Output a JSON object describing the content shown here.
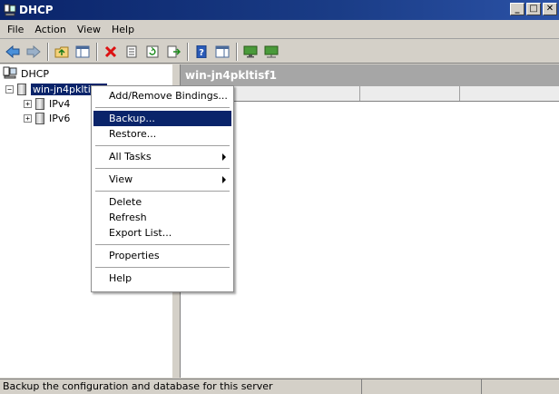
{
  "window": {
    "title": "DHCP",
    "minimize": "_",
    "maximize": "□",
    "close": "✕"
  },
  "menubar": [
    "File",
    "Action",
    "View",
    "Help"
  ],
  "toolbar": {
    "icons": [
      "back-arrow-icon",
      "forward-arrow-icon",
      "up-folder-icon",
      "show-hide-tree-icon",
      "delete-icon",
      "properties-icon",
      "refresh-icon",
      "export-list-icon",
      "help-icon",
      "show-pane-icon",
      "monitor-icon",
      "monitor-network-icon"
    ]
  },
  "tree": {
    "root": "DHCP",
    "server": "win-jn4pkltisf1",
    "children": [
      "IPv4",
      "IPv6"
    ]
  },
  "detail": {
    "header": "win-jn4pkltisf1"
  },
  "context_menu": {
    "items": [
      {
        "label": "Add/Remove Bindings..."
      },
      {
        "separator": true
      },
      {
        "label": "Backup...",
        "highlighted": true
      },
      {
        "label": "Restore..."
      },
      {
        "separator": true
      },
      {
        "label": "All Tasks",
        "submenu": true
      },
      {
        "separator": true
      },
      {
        "label": "View",
        "submenu": true
      },
      {
        "separator": true
      },
      {
        "label": "Delete"
      },
      {
        "label": "Refresh"
      },
      {
        "label": "Export List..."
      },
      {
        "separator": true
      },
      {
        "label": "Properties"
      },
      {
        "separator": true
      },
      {
        "label": "Help"
      }
    ]
  },
  "statusbar": {
    "text": "Backup the configuration and database for this server"
  },
  "colors": {
    "title_bar": "#0a246a",
    "selection": "#0a246a",
    "detail_header": "#a6a6a6"
  }
}
